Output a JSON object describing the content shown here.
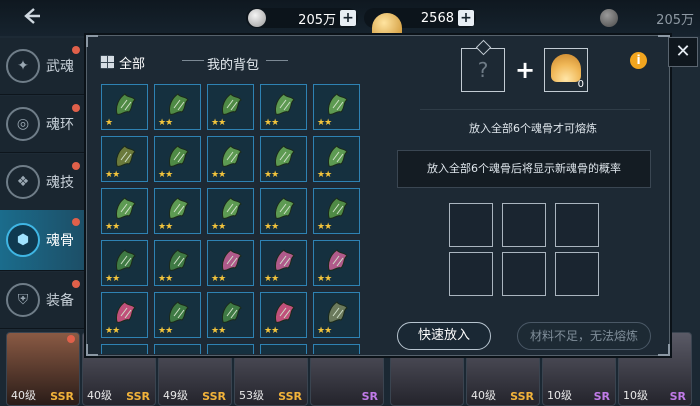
{
  "topbar": {
    "back_icon": "back-arrow-icon",
    "resources": [
      {
        "icon": "silver-coin-icon",
        "value": "205万"
      },
      {
        "icon": "gold-shell-icon",
        "value": "2568"
      },
      {
        "icon": "dark-coin-icon",
        "value": "205万"
      }
    ],
    "plus_symbol": "+"
  },
  "nav": {
    "items": [
      {
        "label": "武魂",
        "icon": "martial-soul-icon",
        "active": false
      },
      {
        "label": "魂环",
        "icon": "soul-ring-icon",
        "active": false
      },
      {
        "label": "魂技",
        "icon": "soul-skill-icon",
        "active": false
      },
      {
        "label": "魂骨",
        "icon": "soul-bone-icon",
        "active": true
      },
      {
        "label": "装备",
        "icon": "equipment-icon",
        "active": false
      }
    ]
  },
  "heroes": [
    {
      "level": "40级",
      "rank": "SSR"
    },
    {
      "level": "40级",
      "rank": "SSR"
    },
    {
      "level": "49级",
      "rank": "SSR"
    },
    {
      "level": "53级",
      "rank": "SSR"
    },
    {
      "level": "",
      "rank": "SR"
    },
    {
      "level": "",
      "rank": ""
    },
    {
      "level": "40级",
      "rank": "SSR"
    },
    {
      "level": "10级",
      "rank": "SR"
    },
    {
      "level": "10级",
      "rank": "SR"
    }
  ],
  "bag": {
    "filter_label": "全部",
    "title": "我的背包",
    "close_symbol": "✕",
    "items": [
      {
        "stars": "★",
        "color": "#4f8a45"
      },
      {
        "stars": "★★",
        "color": "#4f8a45"
      },
      {
        "stars": "★★",
        "color": "#4f8a45"
      },
      {
        "stars": "★★",
        "color": "#5d9a52"
      },
      {
        "stars": "★★",
        "color": "#5d9a52"
      },
      {
        "stars": "★★",
        "color": "#6b7a3c"
      },
      {
        "stars": "★★",
        "color": "#4f8a45"
      },
      {
        "stars": "★★",
        "color": "#5d9a52"
      },
      {
        "stars": "★★",
        "color": "#5d9a52"
      },
      {
        "stars": "★★",
        "color": "#5d9a52"
      },
      {
        "stars": "★★",
        "color": "#5d9a52"
      },
      {
        "stars": "★★",
        "color": "#5d9a52"
      },
      {
        "stars": "★★",
        "color": "#5d9a52"
      },
      {
        "stars": "★★",
        "color": "#5d9a52"
      },
      {
        "stars": "★★",
        "color": "#4f8a45"
      },
      {
        "stars": "★★",
        "color": "#3f7a44"
      },
      {
        "stars": "★★",
        "color": "#3f7a44"
      },
      {
        "stars": "★★",
        "color": "#b05a8a"
      },
      {
        "stars": "★★",
        "color": "#b05a8a"
      },
      {
        "stars": "★★",
        "color": "#b05a8a"
      },
      {
        "stars": "★★",
        "color": "#c0507a"
      },
      {
        "stars": "★★",
        "color": "#3f7a44"
      },
      {
        "stars": "★★",
        "color": "#3f7a44"
      },
      {
        "stars": "★★",
        "color": "#c0507a"
      },
      {
        "stars": "★★",
        "color": "#6b7a5c"
      }
    ]
  },
  "fusion": {
    "unknown_slot": "?",
    "plus": "+",
    "shell_count": "0",
    "info": "i",
    "hint_top": "放入全部6个魂骨才可熔炼",
    "hint_box": "放入全部6个魂骨后将显示新魂骨的概率",
    "quick_btn": "快速放入",
    "fuse_btn": "材料不足，无法熔炼"
  }
}
